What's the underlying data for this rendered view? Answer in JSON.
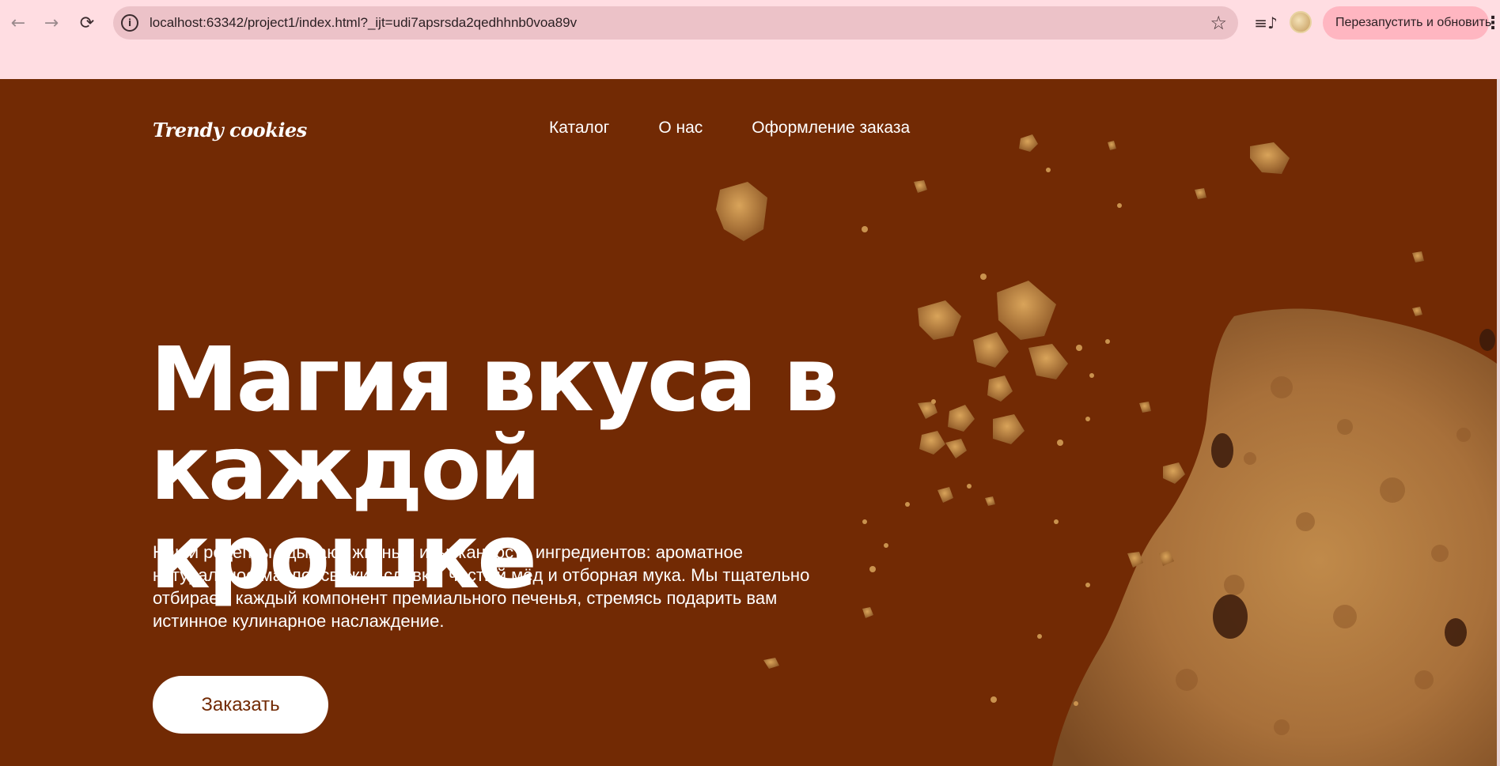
{
  "browser": {
    "url": "localhost:63342/project1/index.html?_ijt=udi7apsrsda2qedhhnb0voa89v",
    "relaunch_label": "Перезапустить и обновить",
    "back_glyph": "←",
    "forward_glyph": "→",
    "reload_glyph": "⟳",
    "info_glyph": "i",
    "star_glyph": "☆",
    "media_glyph": "≡♪",
    "kebab_glyph": "⋮"
  },
  "site": {
    "logo": "Trendy cookies",
    "nav": [
      "Каталог",
      "О нас",
      "Оформление заказа"
    ],
    "hero": {
      "title_line1": "Магия вкуса в",
      "title_line2": "каждой крошке",
      "text": "Наши рецепты вдыхают жизнь в изысканность ингредиентов: ароматное натуральное масло, свежие сливки, чистый мёд и отборная мука. Мы тщательно отбираем каждый компонент премиального печенья, стремясь подарить вам истинное кулинарное наслаждение.",
      "cta": "Заказать"
    },
    "colors": {
      "background": "#722a04",
      "chrome": "#ffdde2",
      "cookie": "#b07a3e",
      "button_text": "#722a04"
    }
  }
}
